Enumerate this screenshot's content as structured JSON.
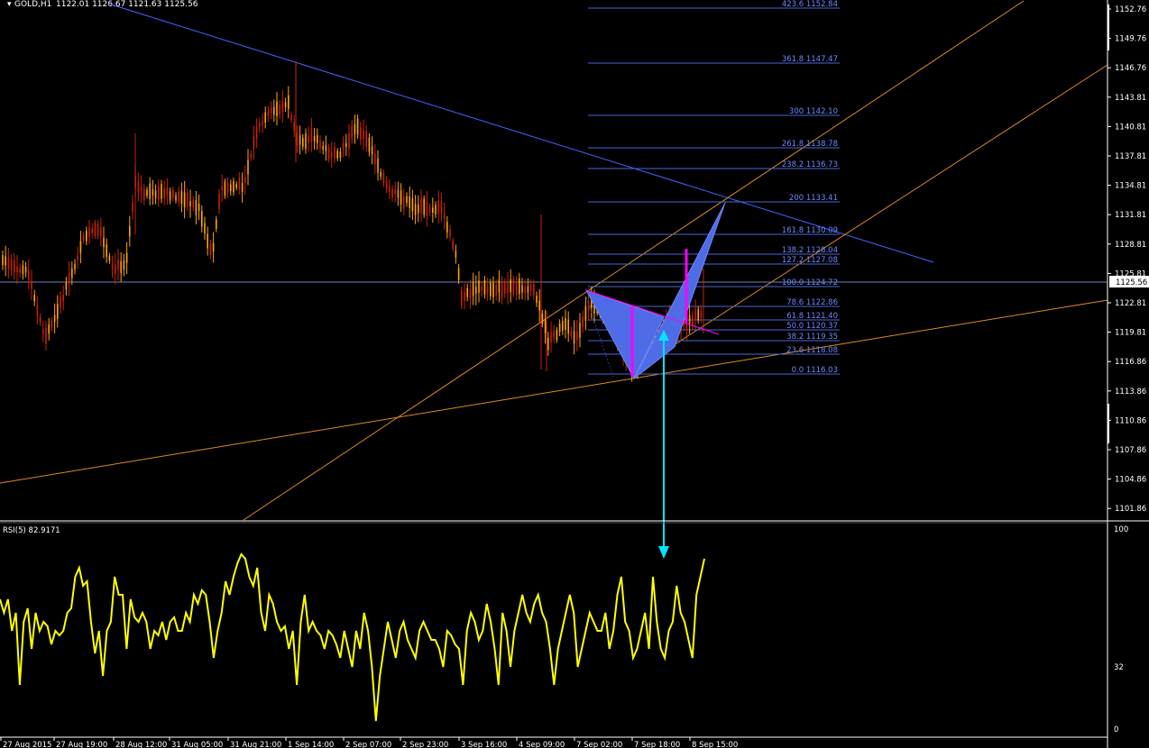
{
  "window": {
    "title": "GOLD,H1",
    "ohlc": "1122.01 1126.67 1121.63 1125.56"
  },
  "price_axis": {
    "labels": [
      "1152.76",
      "1149.76",
      "1146.76",
      "1143.81",
      "1140.81",
      "1137.81",
      "1134.81",
      "1131.81",
      "1128.81",
      "1125.81",
      "1122.81",
      "1119.81",
      "1116.86",
      "1113.86",
      "1110.86",
      "1107.86",
      "1104.86",
      "1101.86"
    ],
    "current_price": "1125.56"
  },
  "fibonacci": {
    "levels": [
      {
        "ratio": "423.6",
        "price": "1152.84"
      },
      {
        "ratio": "361.8",
        "price": "1147.47"
      },
      {
        "ratio": "300",
        "price": "1142.10"
      },
      {
        "ratio": "261.8",
        "price": "1138.78"
      },
      {
        "ratio": "238.2",
        "price": "1136.73"
      },
      {
        "ratio": "200",
        "price": "1133.41"
      },
      {
        "ratio": "161.8",
        "price": "1130.09"
      },
      {
        "ratio": "138.2",
        "price": "1128.04"
      },
      {
        "ratio": "127.2",
        "price": "1127.08"
      },
      {
        "ratio": "100.0",
        "price": "1124.72"
      },
      {
        "ratio": "78.6",
        "price": "1122.86"
      },
      {
        "ratio": "61.8",
        "price": "1121.40"
      },
      {
        "ratio": "50.0",
        "price": "1120.37"
      },
      {
        "ratio": "38.2",
        "price": "1119.35"
      },
      {
        "ratio": "23.6",
        "price": "1118.08"
      },
      {
        "ratio": "0.0",
        "price": "1116.03"
      }
    ]
  },
  "rsi": {
    "title": "RSI(5) 82.9171",
    "axis_labels": [
      "100",
      "32",
      "0"
    ]
  },
  "time_axis": {
    "labels": [
      "27 Aug 2015",
      "27 Aug 19:00",
      "28 Aug 12:00",
      "31 Aug 05:00",
      "31 Aug 21:00",
      "1 Sep 14:00",
      "2 Sep 07:00",
      "2 Sep 23:00",
      "3 Sep 16:00",
      "4 Sep 09:00",
      "7 Sep 02:00",
      "7 Sep 18:00",
      "8 Sep 15:00"
    ]
  },
  "colors": {
    "background": "#000000",
    "bull_candle": "#ffa500",
    "bear_candle": "#cc2200",
    "trendline": "#4466ff",
    "channel": "#e08a1e",
    "fib": "#4a66d8",
    "pattern": "#4f6be6",
    "marker": "#ff00ff",
    "arrow": "#00e5ff",
    "rsi": "#ffff00"
  }
}
